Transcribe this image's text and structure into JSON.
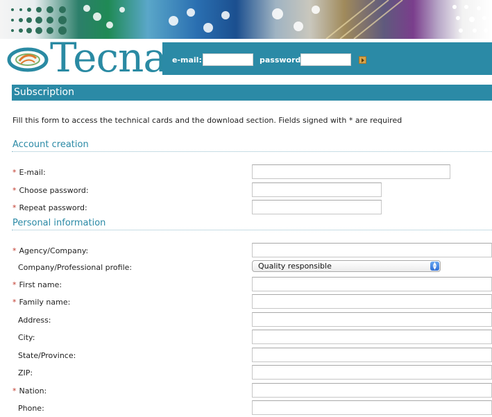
{
  "header": {
    "brand": "Tecna",
    "login": {
      "email_label": "e-mail:",
      "password_label": "password:",
      "email_value": "",
      "password_value": ""
    }
  },
  "page": {
    "title": "Subscription",
    "intro": "Fill this form to access the technical cards and the download section. Fields signed with * are required"
  },
  "sections": {
    "account": {
      "title": "Account creation",
      "email_label": "E-mail:",
      "choose_password_label": "Choose password:",
      "repeat_password_label": "Repeat password:"
    },
    "personal": {
      "title": "Personal information",
      "agency_label": "Agency/Company:",
      "profile_label": "Company/Professional profile:",
      "profile_selected": "Quality responsible",
      "first_name_label": "First name:",
      "family_name_label": "Family name:",
      "address_label": "Address:",
      "city_label": "City:",
      "state_label": "State/Province:",
      "zip_label": "ZIP:",
      "nation_label": "Nation:",
      "phone_label": "Phone:"
    }
  },
  "required_marker": "*",
  "colors": {
    "accent": "#2b8aa6",
    "required": "#c0392b",
    "logo": "#2a8aa3"
  }
}
